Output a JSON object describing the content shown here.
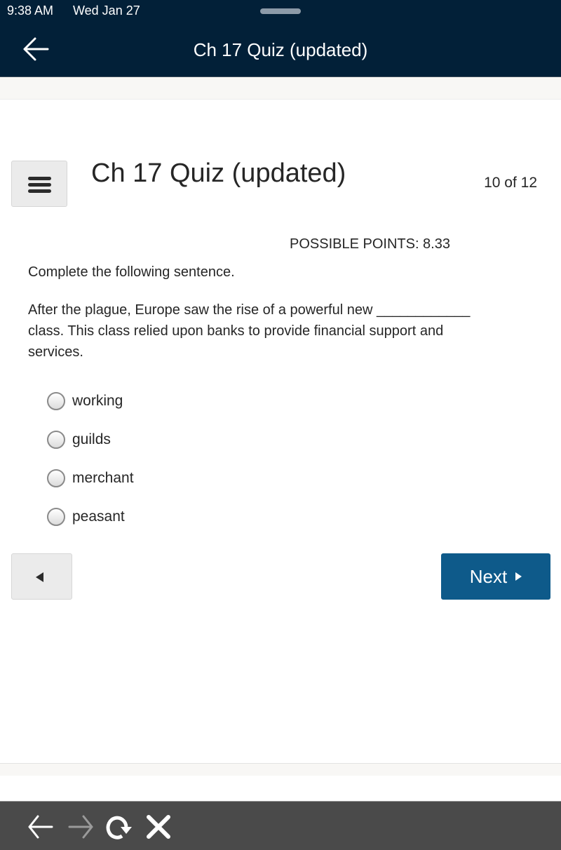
{
  "status_bar": {
    "time": "9:38 AM",
    "date": "Wed Jan 27"
  },
  "nav": {
    "title": "Ch 17 Quiz (updated)",
    "back_icon": "arrow-left-icon"
  },
  "quiz": {
    "title": "Ch 17 Quiz (updated)",
    "progress": "10 of 12",
    "menu_icon": "hamburger-menu-icon",
    "possible_points": "POSSIBLE POINTS: 8.33",
    "instruction": "Complete the following sentence.",
    "question": "After the plague, Europe saw the rise of a powerful new ____________ class.  This class relied upon banks to provide financial support and services.",
    "options": [
      {
        "label": "working",
        "selected": false
      },
      {
        "label": "guilds",
        "selected": false
      },
      {
        "label": "merchant",
        "selected": false
      },
      {
        "label": "peasant",
        "selected": false
      }
    ]
  },
  "navigation": {
    "prev_icon": "triangle-left-icon",
    "next_label": "Next",
    "next_icon": "triangle-right-icon",
    "next_color": "#0e5a8a"
  },
  "browser_toolbar": {
    "icons": [
      "back-arrow-icon",
      "forward-arrow-icon",
      "reload-icon",
      "close-icon"
    ]
  },
  "colors": {
    "header_bg": "#022038",
    "toolbar_bg": "#4a4a4a",
    "accent": "#0e5a8a"
  }
}
